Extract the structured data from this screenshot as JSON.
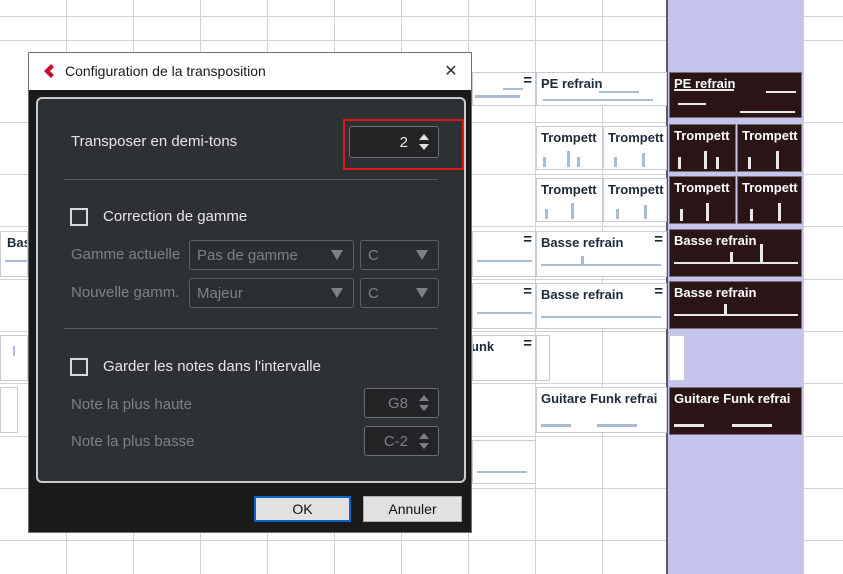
{
  "dialog": {
    "title": "Configuration de la transposition",
    "close_glyph": "✕",
    "transpose": {
      "label": "Transposer en demi-tons",
      "value": "2"
    },
    "scale_correction": {
      "checkbox_label": "Correction de gamme",
      "current_scale": {
        "label": "Gamme actuelle",
        "type": "Pas de gamme",
        "root": "C"
      },
      "new_scale": {
        "label": "Nouvelle gamm.",
        "type": "Majeur",
        "root": "C"
      }
    },
    "keep_in_range": {
      "checkbox_label": "Garder les notes dans l'intervalle",
      "highest": {
        "label": "Note la plus haute",
        "value": "G8"
      },
      "lowest": {
        "label": "Note la plus basse",
        "value": "C-2"
      }
    },
    "ok_label": "OK",
    "cancel_label": "Annuler"
  },
  "arrangement": {
    "events": [
      {
        "label": "PE refrain"
      },
      {
        "label": "PE refrain"
      },
      {
        "label": "Trompett"
      },
      {
        "label": "Trompett"
      },
      {
        "label": "Trompett"
      },
      {
        "label": "Trompett"
      },
      {
        "label": "Trompett"
      },
      {
        "label": "Trompett"
      },
      {
        "label": "Trompett"
      },
      {
        "label": "Trompett"
      },
      {
        "label": "Basse refrain"
      },
      {
        "label": "Basse refrain"
      },
      {
        "label": "Basse refrain"
      },
      {
        "label": "Basse refrain"
      },
      {
        "label": "Guitare Funk refrai"
      },
      {
        "label": "Guitare Funk refrai"
      },
      {
        "label": "Bas"
      },
      {
        "label": "unk"
      }
    ],
    "equals_glyph": "="
  },
  "colors": {
    "accent_blue": "#0a64c8",
    "highlight_red": "#e01717",
    "cycle_region": "#c5c4ee",
    "selected_event": "#2b1416",
    "dialog_bg": "#2e3134",
    "logo_red": "#c8102e"
  },
  "icons": {
    "logo": "cubase-logo-icon",
    "close": "close-icon",
    "spin": "spin-arrows-icon",
    "dropdown": "chevron-down-icon"
  }
}
